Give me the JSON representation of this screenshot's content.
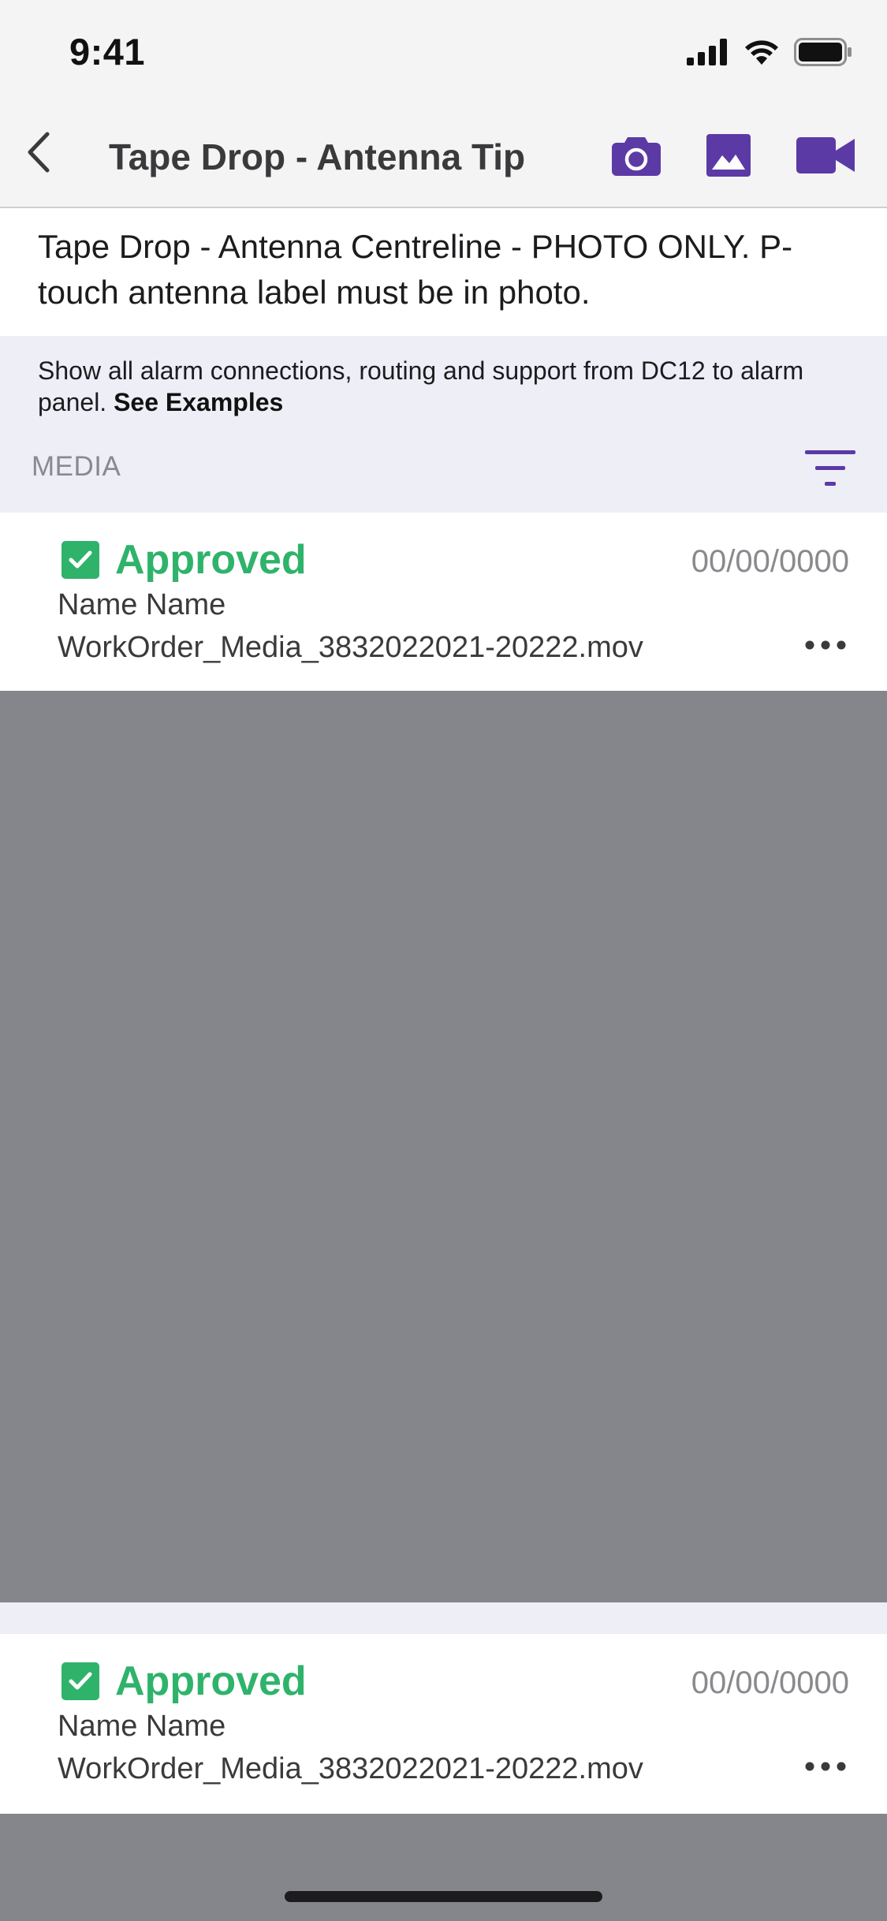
{
  "status_bar": {
    "time": "9:41"
  },
  "nav": {
    "title": "Tape Drop - Antenna Tip",
    "back_icon": "chevron-left-icon",
    "actions": [
      "camera-icon",
      "image-icon",
      "video-camera-icon"
    ]
  },
  "task": {
    "description": "Tape Drop - Antenna Centreline - PHOTO ONLY. P-touch antenna label must be in photo."
  },
  "instructions": {
    "text": "Show all alarm connections, routing and support from DC12 to alarm panel.",
    "link_label": "See Examples"
  },
  "media": {
    "section_label": "MEDIA",
    "filter_icon": "filter-icon",
    "items": [
      {
        "status": "Approved",
        "date": "00/00/0000",
        "name": "Name Name",
        "filename": "WorkOrder_Media_3832022021-20222.mov"
      },
      {
        "status": "Approved",
        "date": "00/00/0000",
        "name": "Name Name",
        "filename": "WorkOrder_Media_3832022021-20222.mov"
      }
    ]
  },
  "colors": {
    "accent_purple": "#5b3aa6",
    "approved_green": "#2fb36b",
    "preview_gray": "#85868b",
    "instruction_band": "#eeeef7"
  }
}
